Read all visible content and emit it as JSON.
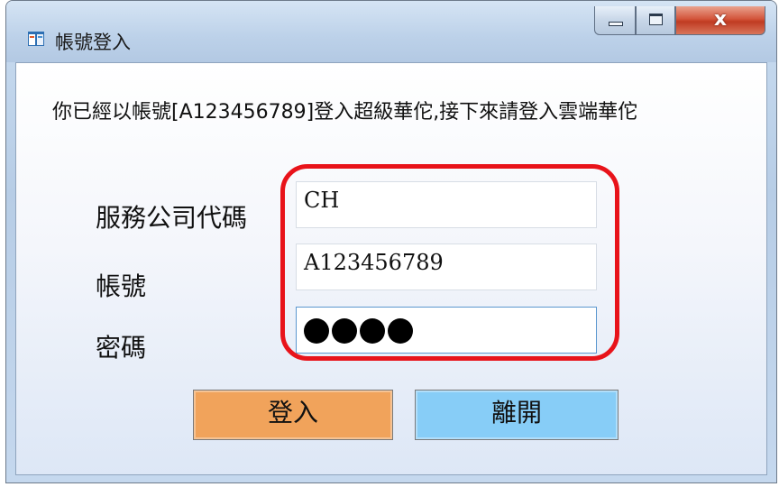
{
  "window": {
    "title": "帳號登入",
    "controls": {
      "minimize": "minimize",
      "maximize": "maximize",
      "close_glyph": "x"
    }
  },
  "notice": "你已經以帳號[A123456789]登入超級華佗,接下來請登入雲端華佗",
  "form": {
    "company_code": {
      "label": "服務公司代碼",
      "value": "CH"
    },
    "account": {
      "label": "帳號",
      "value": "A123456789"
    },
    "password": {
      "label": "密碼",
      "masked_length": 4
    }
  },
  "buttons": {
    "login": "登入",
    "exit": "離開"
  },
  "colors": {
    "login_button": "#f1a35b",
    "exit_button": "#87cdf7",
    "highlight": "#e8131a"
  },
  "icons": {
    "app": "window-app-icon",
    "close": "close-icon"
  }
}
